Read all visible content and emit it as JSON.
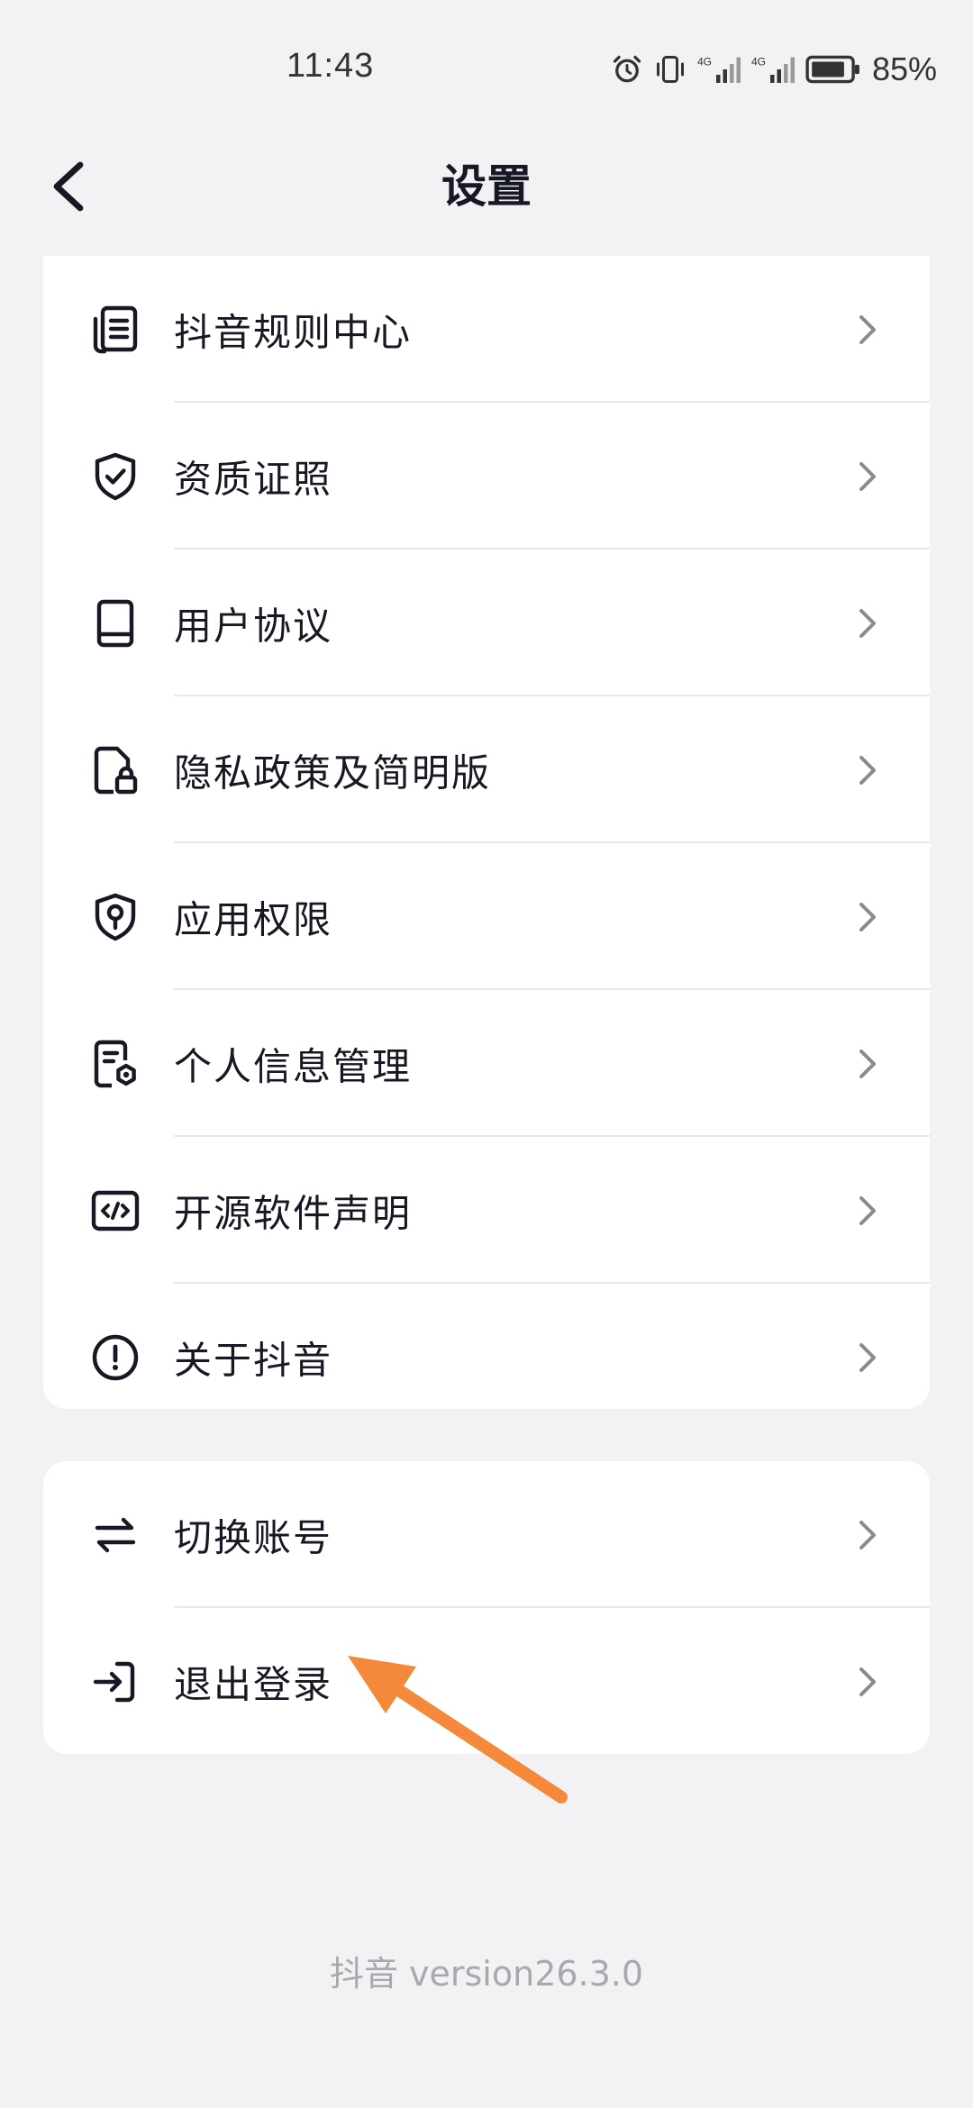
{
  "status": {
    "time": "11:43",
    "battery": "85%",
    "network_label_1": "4G",
    "network_label_2": "4G"
  },
  "nav": {
    "title": "设置"
  },
  "section1": {
    "items": [
      {
        "label": "抖音规则中心",
        "icon": "document-list-icon"
      },
      {
        "label": "资质证照",
        "icon": "shield-check-icon"
      },
      {
        "label": "用户协议",
        "icon": "book-icon"
      },
      {
        "label": "隐私政策及简明版",
        "icon": "file-lock-icon"
      },
      {
        "label": "应用权限",
        "icon": "shield-key-icon"
      },
      {
        "label": "个人信息管理",
        "icon": "file-gear-icon"
      },
      {
        "label": "开源软件声明",
        "icon": "code-icon"
      },
      {
        "label": "关于抖音",
        "icon": "info-circle-icon"
      }
    ]
  },
  "section2": {
    "items": [
      {
        "label": "切换账号",
        "icon": "switch-arrows-icon"
      },
      {
        "label": "退出登录",
        "icon": "logout-icon"
      }
    ]
  },
  "annotation": {
    "arrow_color": "#f5893a"
  },
  "footer": {
    "version": "抖音 version26.3.0"
  }
}
